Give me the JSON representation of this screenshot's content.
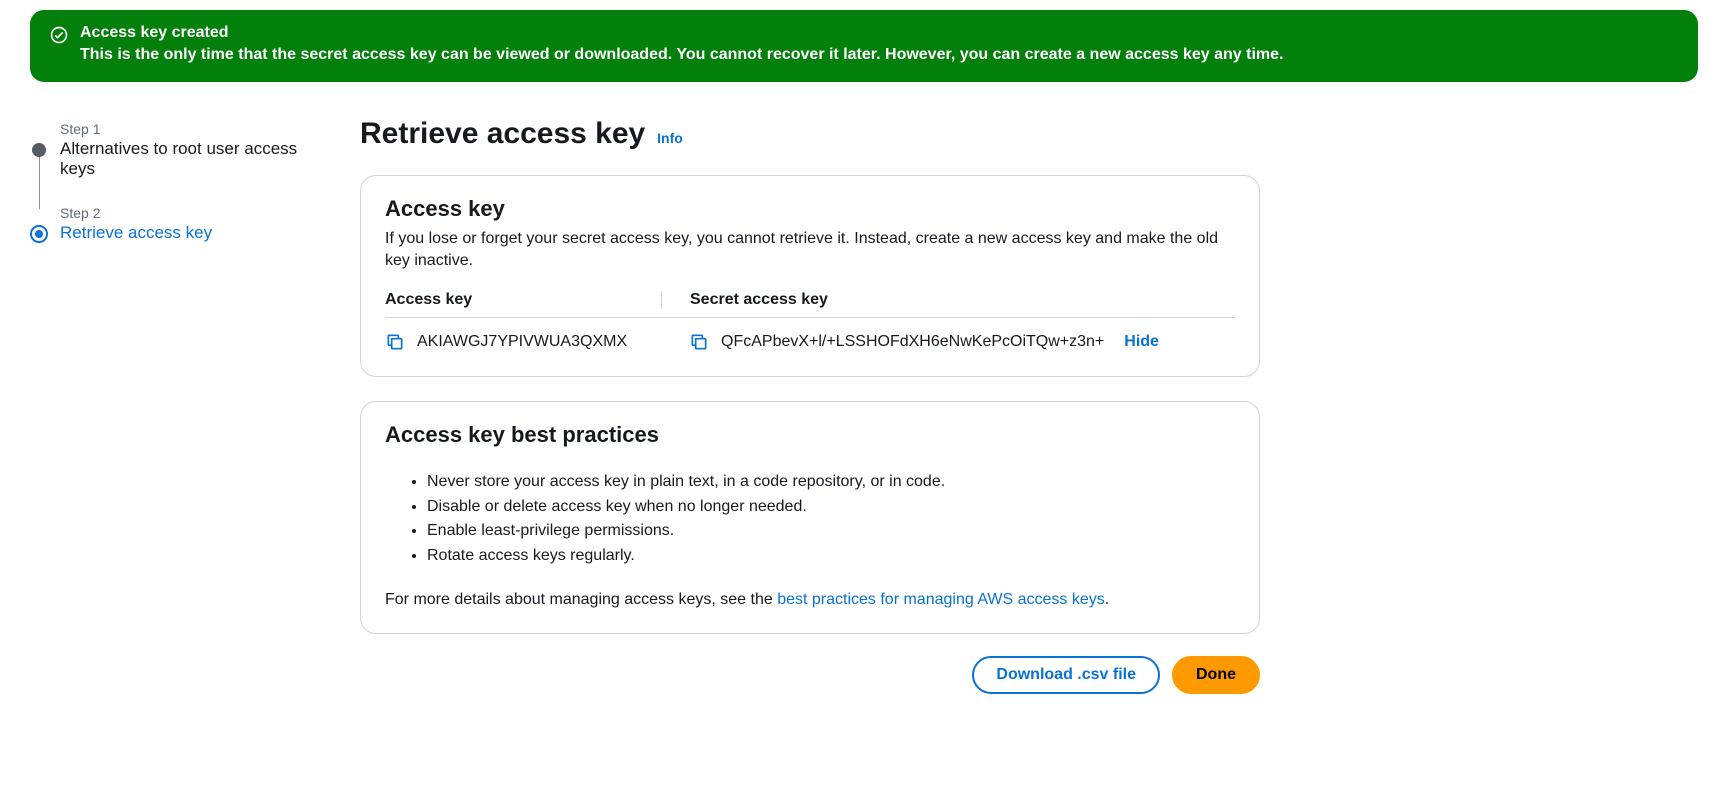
{
  "banner": {
    "title": "Access key created",
    "description": "This is the only time that the secret access key can be viewed or downloaded. You cannot recover it later. However, you can create a new access key any time."
  },
  "steps": [
    {
      "label": "Step 1",
      "title": "Alternatives to root user access keys",
      "active": false
    },
    {
      "label": "Step 2",
      "title": "Retrieve access key",
      "active": true
    }
  ],
  "header": {
    "title": "Retrieve access key",
    "info": "Info"
  },
  "access_card": {
    "title": "Access key",
    "description": "If you lose or forget your secret access key, you cannot retrieve it. Instead, create a new access key and make the old key inactive.",
    "col1_label": "Access key",
    "col2_label": "Secret access key",
    "access_key": "AKIAWGJ7YPIVWUA3QXMX",
    "secret_key": "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",
    "hide_label": "Hide"
  },
  "best_practices": {
    "title": "Access key best practices",
    "items": [
      "Never store your access key in plain text, in a code repository, or in code.",
      "Disable or delete access key when no longer needed.",
      "Enable least-privilege permissions.",
      "Rotate access keys regularly."
    ],
    "footer_prefix": "For more details about managing access keys, see the ",
    "footer_link": "best practices for managing AWS access keys",
    "footer_suffix": "."
  },
  "actions": {
    "download": "Download .csv file",
    "done": "Done"
  }
}
